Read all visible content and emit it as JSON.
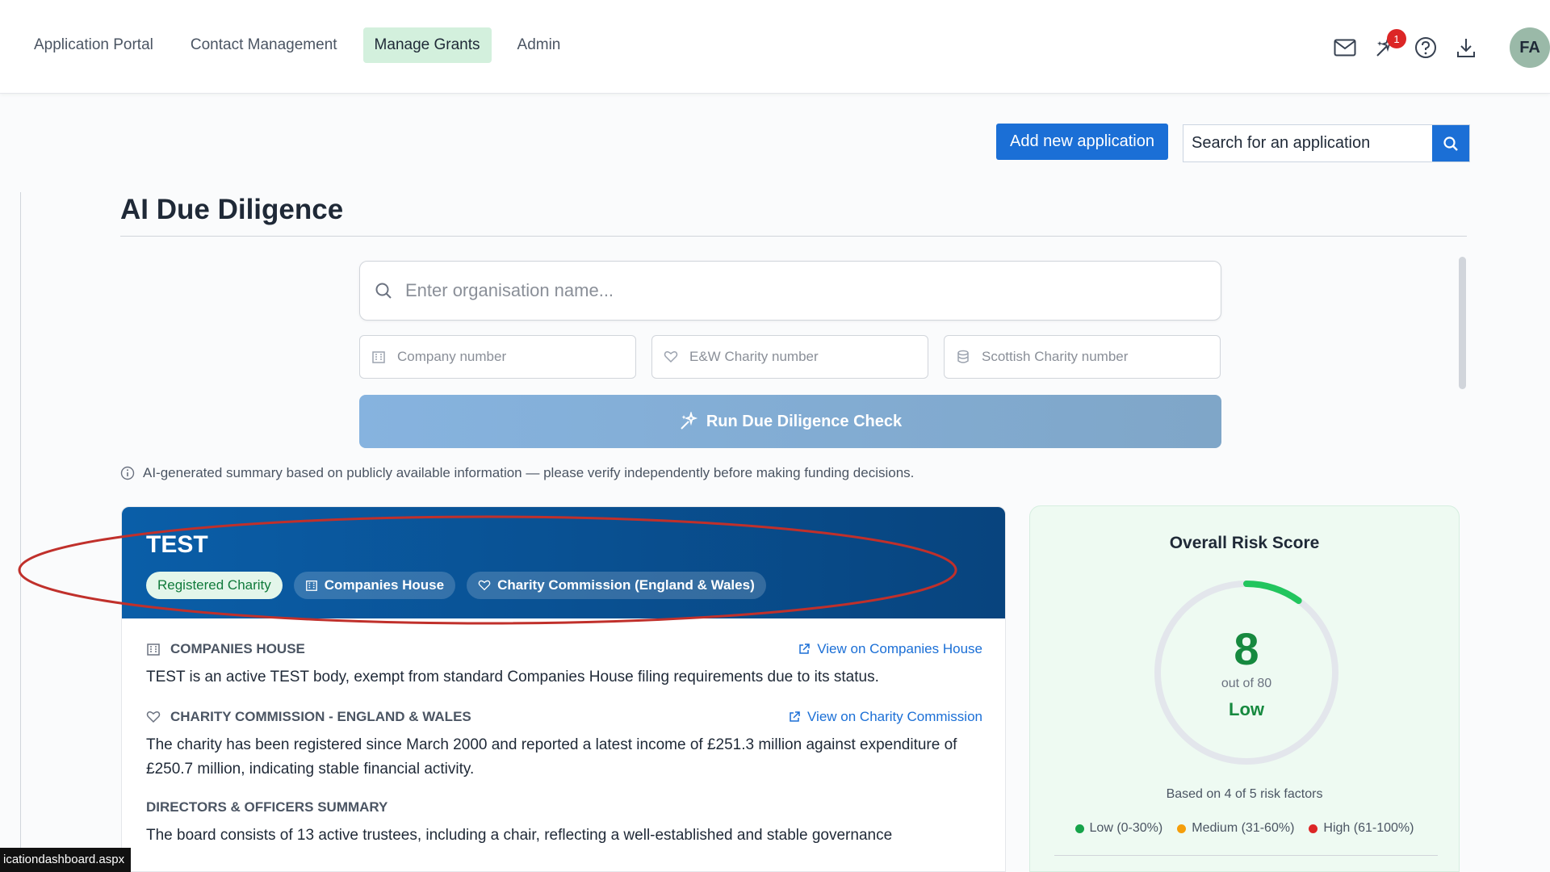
{
  "nav": {
    "items": [
      {
        "label": "Application Portal",
        "active": false
      },
      {
        "label": "Contact Management",
        "active": false
      },
      {
        "label": "Manage Grants",
        "active": true
      },
      {
        "label": "Admin",
        "active": false
      }
    ],
    "notification_count": "1",
    "avatar_initials": "FA",
    "icons": [
      "mail-icon",
      "sparkle-icon",
      "help-icon",
      "download-icon"
    ]
  },
  "actions": {
    "add_label": "Add new application",
    "search_placeholder": "Search for an application"
  },
  "page": {
    "title": "AI Due Diligence"
  },
  "form": {
    "org_placeholder": "Enter organisation name...",
    "company_placeholder": "Company number",
    "ew_placeholder": "E&W Charity number",
    "scottish_placeholder": "Scottish Charity number",
    "run_label": "Run Due Diligence Check",
    "disclaimer": "AI-generated summary based on publicly available information — please verify independently before making funding decisions."
  },
  "result": {
    "org_name": "TEST",
    "tags": [
      "Registered Charity",
      "Companies House",
      "Charity Commission (England & Wales)"
    ],
    "sections": [
      {
        "title": "COMPANIES HOUSE",
        "link": "View on Companies House",
        "text": "TEST is an active TEST body, exempt from standard Companies House filing requirements due to its status."
      },
      {
        "title": "CHARITY COMMISSION - ENGLAND & WALES",
        "link": "View on Charity Commission",
        "text": "The charity has been registered since March 2000 and reported a latest income of £251.3 million against expenditure of £250.7 million, indicating stable financial activity."
      },
      {
        "title": "DIRECTORS & OFFICERS SUMMARY",
        "link": "",
        "text": "The board consists of 13 active trustees, including a chair, reflecting a well-established and stable governance"
      }
    ]
  },
  "risk": {
    "title": "Overall Risk Score",
    "score": "8",
    "out_of": "out of 80",
    "score_fraction": 0.1,
    "level": "Low",
    "basis": "Based on 4 of 5 risk factors",
    "legend": [
      {
        "label": "Low (0-30%)",
        "color": "#16a34a"
      },
      {
        "label": "Medium (31-60%)",
        "color": "#f59e0b"
      },
      {
        "label": "High (61-100%)",
        "color": "#dc2626"
      }
    ]
  },
  "status_url": "icationdashboard.aspx",
  "colors": {
    "accent": "#1b6fd6",
    "header_blue": "#0a5ea8",
    "low_green": "#16893f",
    "annotation_red": "#c0302b"
  }
}
